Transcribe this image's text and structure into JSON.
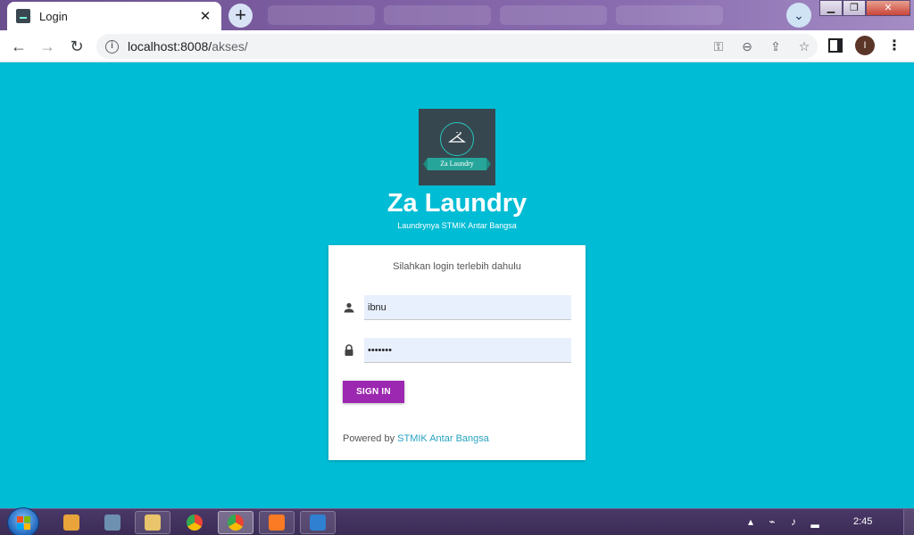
{
  "browser": {
    "tab_title": "Login",
    "tab_close": "✕",
    "new_tab": "+",
    "url_host": "localhost:8008/",
    "url_path": "akses/",
    "profile_initial": "I"
  },
  "window_controls": {
    "minimize": "▁",
    "restore": "❐",
    "close": "✕"
  },
  "page": {
    "logo_ribbon_text": "Za Laundry",
    "title": "Za Laundry",
    "subtitle": "Laundrynya STMIK Antar Bangsa",
    "card_message": "Silahkan login terlebih dahulu",
    "username_value": "ibnu",
    "password_value": "•••••••",
    "signin_label": "SIGN IN",
    "powered_prefix": "Powered by ",
    "powered_link": "STMIK Antar Bangsa"
  },
  "taskbar": {
    "clock": "2:45"
  },
  "colors": {
    "background": "#00bcd4",
    "signin_button": "#9c27b0",
    "link": "#26a3c2",
    "logo_bg": "#37474f",
    "ribbon": "#26a69a"
  }
}
